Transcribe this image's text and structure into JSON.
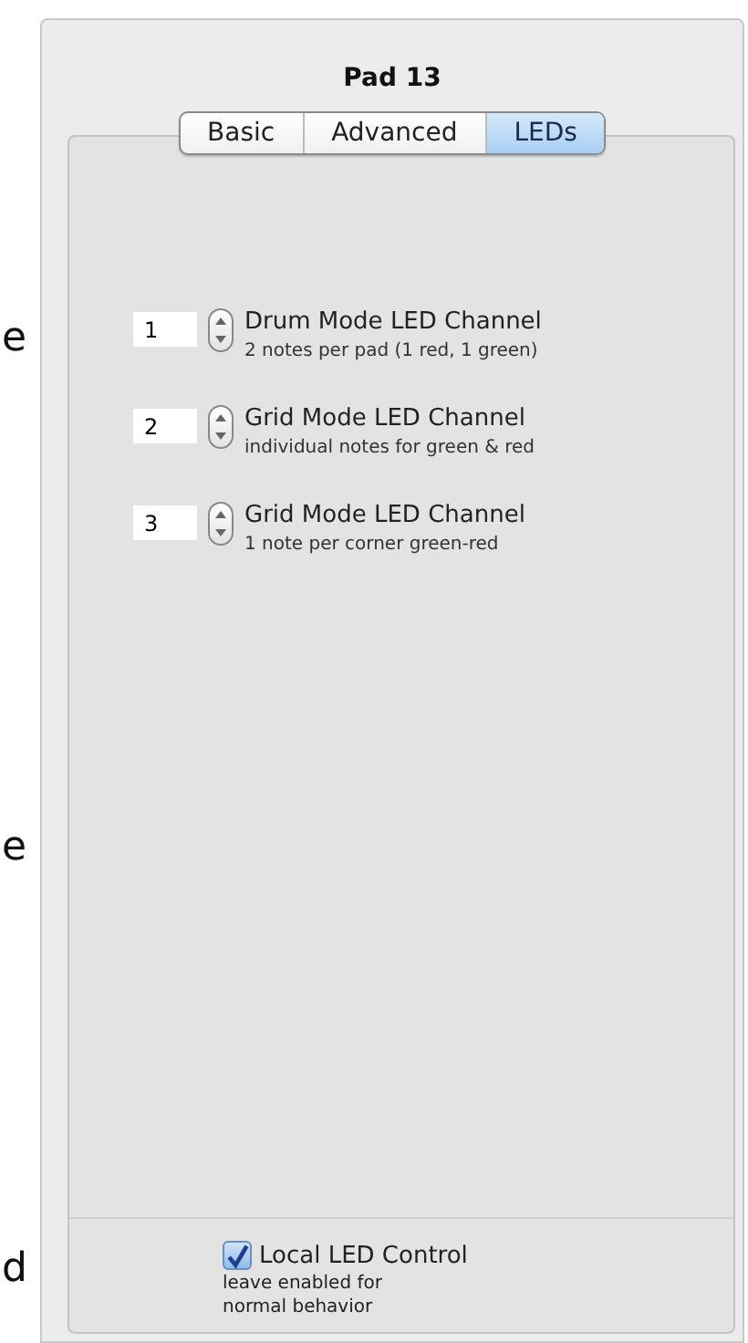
{
  "left_edge_letters": [
    "e",
    "e",
    "d"
  ],
  "title": "Pad 13",
  "tabs": [
    {
      "label": "Basic",
      "selected": false
    },
    {
      "label": "Advanced",
      "selected": false
    },
    {
      "label": "LEDs",
      "selected": true
    }
  ],
  "channels": [
    {
      "value": "1",
      "label": "Drum Mode LED Channel",
      "note": "2 notes per pad (1 red, 1 green)"
    },
    {
      "value": "2",
      "label": "Grid Mode LED Channel",
      "note": "individual notes for green & red"
    },
    {
      "value": "3",
      "label": "Grid Mode LED Channel",
      "note": "1 note per corner green-red"
    }
  ],
  "local_control": {
    "label": "Local LED Control",
    "checked": true,
    "note_lines": [
      "leave enabled for",
      "normal behavior"
    ]
  }
}
